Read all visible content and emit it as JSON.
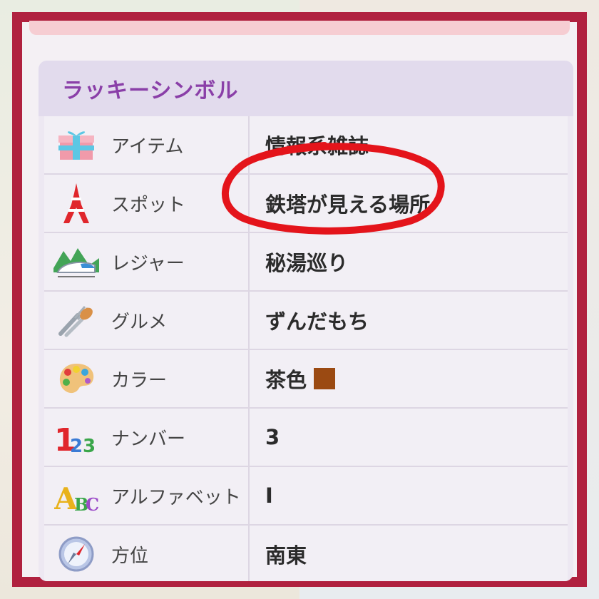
{
  "panel": {
    "title": "ラッキーシンボル",
    "rows": [
      {
        "icon": "gift-box-icon",
        "label": "アイテム",
        "value": "情報系雑誌"
      },
      {
        "icon": "tokyo-tower-icon",
        "label": "スポット",
        "value": "鉄塔が見える場所"
      },
      {
        "icon": "train-mountain-icon",
        "label": "レジャー",
        "value": "秘湯巡り"
      },
      {
        "icon": "fork-spoon-icon",
        "label": "グルメ",
        "value": "ずんだもち"
      },
      {
        "icon": "paint-palette-icon",
        "label": "カラー",
        "value": "茶色",
        "swatch": "#9b4a12"
      },
      {
        "icon": "numbers-123-icon",
        "label": "ナンバー",
        "value": "3"
      },
      {
        "icon": "abc-letters-icon",
        "label": "アルファベット",
        "value": "I"
      },
      {
        "icon": "compass-icon",
        "label": "方位",
        "value": "南東"
      }
    ]
  },
  "colors": {
    "frame": "#b0213f",
    "title": "#8a3fa8",
    "annotation": "#e4141b"
  }
}
